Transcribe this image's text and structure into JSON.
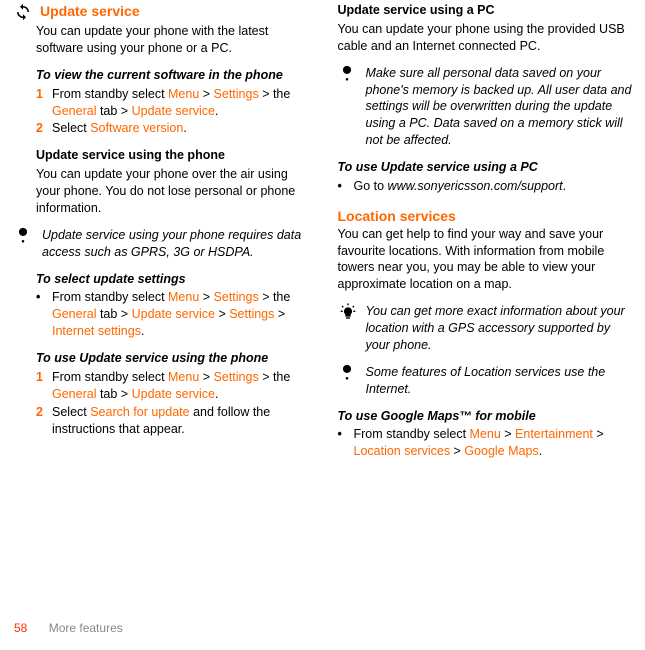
{
  "left": {
    "h1": "Update service",
    "intro": "You can update your phone with the latest software using your phone or a PC.",
    "viewHead": "To view the current software in the phone",
    "view": {
      "s1a": "From standby select ",
      "menu": "Menu",
      "gt": " > ",
      "settings": "Settings",
      "sThe": " > the ",
      "general": "General",
      "sTab": " tab > ",
      "updService": "Update service",
      "period": ".",
      "s2a": "Select ",
      "softver": "Software version"
    },
    "phoneHead": "Update service using the phone",
    "phoneBody": "You can update your phone over the air using your phone. You do not lose personal or phone information.",
    "note1": "Update service using your phone requires data access such as GPRS, 3G or HSDPA.",
    "selectHead": "To select update settings",
    "select": {
      "a": "From standby select ",
      "menu": "Menu",
      "gt": " > ",
      "settings": "Settings",
      "sThe": " > the ",
      "general": "General",
      "sTab": " tab > ",
      "updService": "Update service",
      "settings2": "Settings",
      "internet": "Internet settings",
      "period": "."
    },
    "usePhoneHead": "To use Update service using the phone",
    "use": {
      "a": "From standby select ",
      "menu": "Menu",
      "gt": " > ",
      "settings": "Settings",
      "sThe": " > the ",
      "general": "General",
      "sTab": " tab > ",
      "updService": "Update service",
      "period": ".",
      "b": "Select ",
      "search": "Search for update",
      "c": " and follow the instructions that appear."
    }
  },
  "right": {
    "pcHead": "Update service using a PC",
    "pcBody": "You can update your phone using the provided USB cable and an Internet connected PC.",
    "note2": "Make sure all personal data saved on your phone's memory is backed up. All user data and settings will be overwritten during the update using a PC. Data saved on a memory stick will not be affected.",
    "usePCHead": "To use Update service using a PC",
    "usePC": {
      "a": "Go to ",
      "url": "www.sonyericsson.com/support",
      "period": "."
    },
    "locHead": "Location services",
    "locBody": "You can get help to find your way and save your favourite locations. With information from mobile towers near you, you may be able to view your approximate location on a map.",
    "tip": "You can get more exact information about your location with a GPS accessory supported by your phone.",
    "note3": "Some features of Location services use the Internet.",
    "gmapsHead": "To use Google Maps™ for mobile",
    "gmaps": {
      "a": "From standby select ",
      "menu": "Menu",
      "gt": " > ",
      "ent": "Entertainment",
      "loc": "Location services",
      "gm": "Google Maps",
      "period": "."
    }
  },
  "footer": {
    "page": "58",
    "chapter": "More features"
  }
}
